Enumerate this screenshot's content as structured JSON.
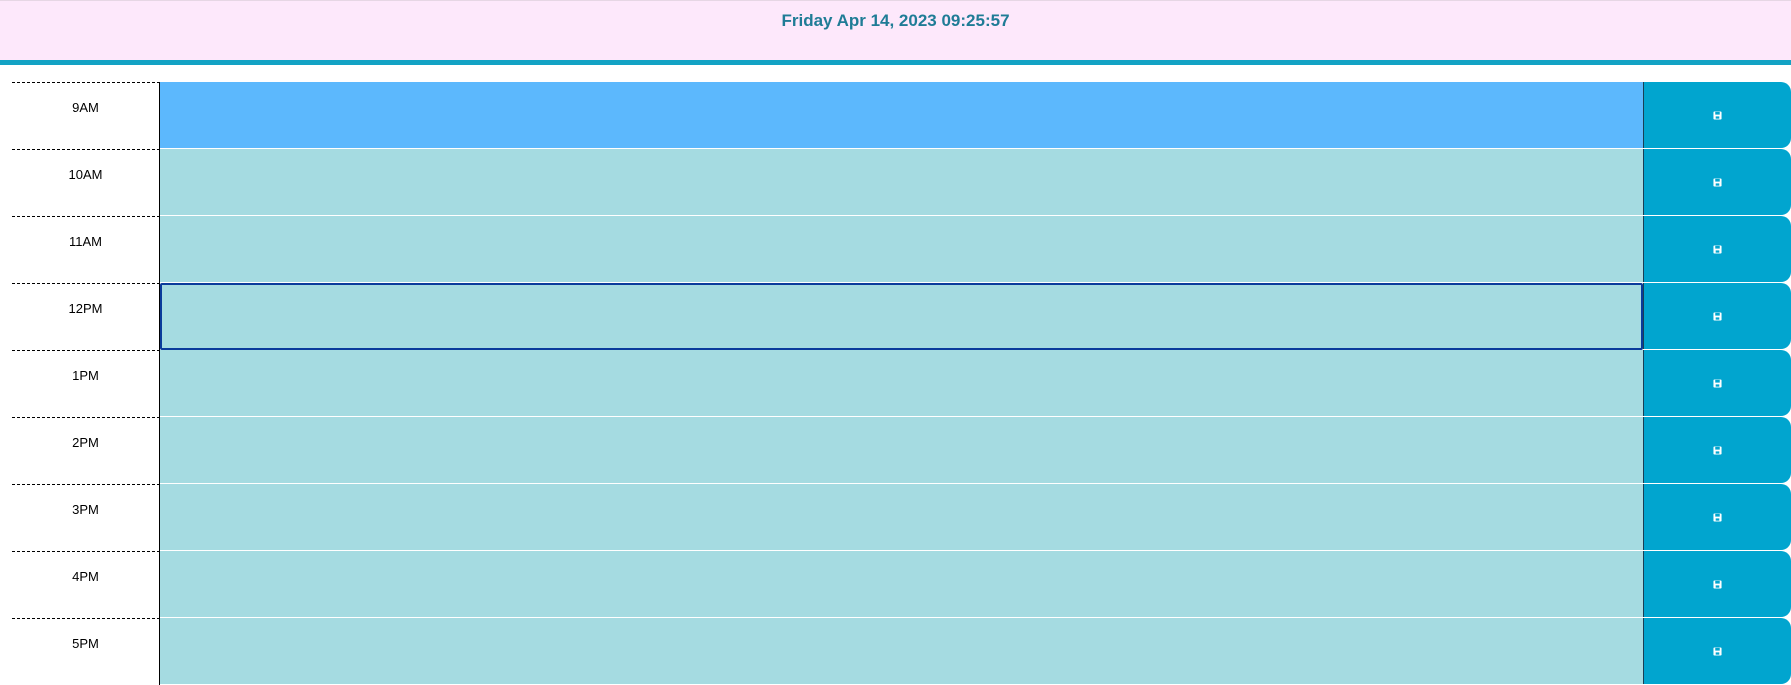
{
  "header": {
    "datetime": "Friday Apr 14, 2023 09:25:57"
  },
  "colors": {
    "present": "#5cb8fd",
    "future": "#a5dbe1",
    "save_button": "#01a5cf",
    "header_bg": "#fde8fb",
    "header_border": "#13a2c4",
    "title": "#1f7c96"
  },
  "rows": [
    {
      "hour": "9AM",
      "text": "",
      "state": "present",
      "focused": false,
      "icon": "save-icon"
    },
    {
      "hour": "10AM",
      "text": "",
      "state": "future",
      "focused": false,
      "icon": "save-icon"
    },
    {
      "hour": "11AM",
      "text": "",
      "state": "future",
      "focused": false,
      "icon": "save-icon"
    },
    {
      "hour": "12PM",
      "text": "",
      "state": "future",
      "focused": true,
      "icon": "save-icon"
    },
    {
      "hour": "1PM",
      "text": "",
      "state": "future",
      "focused": false,
      "icon": "save-icon"
    },
    {
      "hour": "2PM",
      "text": "",
      "state": "future",
      "focused": false,
      "icon": "save-icon"
    },
    {
      "hour": "3PM",
      "text": "",
      "state": "future",
      "focused": false,
      "icon": "save-icon"
    },
    {
      "hour": "4PM",
      "text": "",
      "state": "future",
      "focused": false,
      "icon": "save-icon"
    },
    {
      "hour": "5PM",
      "text": "",
      "state": "future",
      "focused": false,
      "icon": "save-icon"
    }
  ]
}
